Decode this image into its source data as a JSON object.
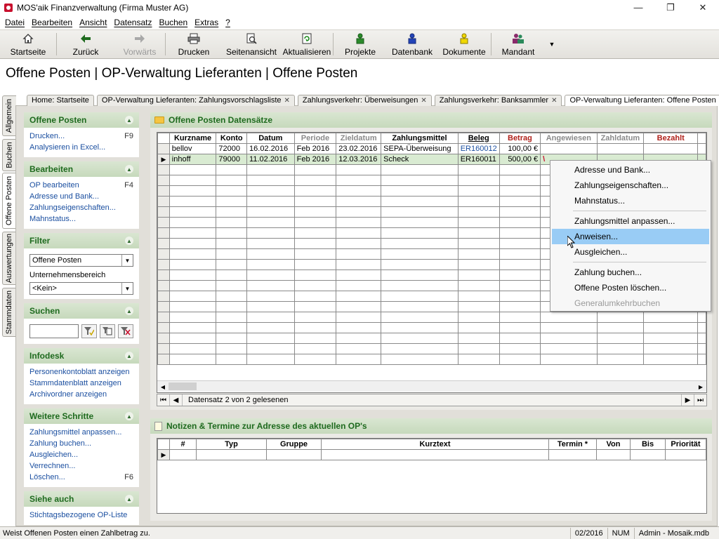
{
  "window": {
    "title": "MOS'aik Finanzverwaltung (Firma Muster AG)",
    "minimize": "—",
    "restore": "❐",
    "close": "✕"
  },
  "menubar": [
    "Datei",
    "Bearbeiten",
    "Ansicht",
    "Datensatz",
    "Buchen",
    "Extras",
    "?"
  ],
  "toolbar": {
    "startseite": "Startseite",
    "zurueck": "Zurück",
    "vorwaerts": "Vorwärts",
    "drucken": "Drucken",
    "seitenansicht": "Seitenansicht",
    "aktualisieren": "Aktualisieren",
    "projekte": "Projekte",
    "datenbank": "Datenbank",
    "dokumente": "Dokumente",
    "mandant": "Mandant"
  },
  "heading": "Offene Posten | OP-Verwaltung Lieferanten | Offene Posten",
  "vtabs": [
    "Allgemein",
    "Buchen",
    "Offene Posten",
    "Auswertungen",
    "Stammdaten"
  ],
  "htabs": [
    "Home: Startseite",
    "OP-Verwaltung Lieferanten: Zahlungsvorschlagsliste",
    "Zahlungsverkehr: Überweisungen",
    "Zahlungsverkehr: Banksammler",
    "OP-Verwaltung Lieferanten: Offene Posten"
  ],
  "left": {
    "offene_posten": {
      "title": "Offene Posten",
      "drucken": "Drucken...",
      "drucken_key": "F9",
      "excel": "Analysieren in Excel..."
    },
    "bearbeiten": {
      "title": "Bearbeiten",
      "op": "OP bearbeiten",
      "op_key": "F4",
      "adresse": "Adresse und Bank...",
      "zahlung": "Zahlungseigenschaften...",
      "mahn": "Mahnstatus..."
    },
    "filter": {
      "title": "Filter",
      "value": "Offene Posten",
      "label": "Unternehmensbereich",
      "bereich": "<Kein>"
    },
    "suchen": {
      "title": "Suchen"
    },
    "infodesk": {
      "title": "Infodesk",
      "a": "Personenkontoblatt anzeigen",
      "b": "Stammdatenblatt anzeigen",
      "c": "Archivordner anzeigen"
    },
    "weitere": {
      "title": "Weitere Schritte",
      "a": "Zahlungsmittel anpassen...",
      "b": "Zahlung buchen...",
      "c": "Ausgleichen...",
      "d": "Verrechnen...",
      "e": "Löschen...",
      "e_key": "F6"
    },
    "siehe": {
      "title": "Siehe auch",
      "a": "Stichtagsbezogene OP-Liste"
    }
  },
  "panel1": {
    "title": "Offene Posten Datensätze",
    "columns": [
      "Kurzname",
      "Konto",
      "Datum",
      "Periode",
      "Zieldatum",
      "Zahlungsmittel",
      "Beleg",
      "Betrag",
      "Angewiesen",
      "Zahldatum",
      "Bezahlt"
    ],
    "rows": [
      [
        "bellov",
        "72000",
        "16.02.2016",
        "Feb 2016",
        "23.02.2016",
        "SEPA-Überweisung",
        "ER160012",
        "100,00 €",
        "",
        "",
        ""
      ],
      [
        "inhoff",
        "79000",
        "11.02.2016",
        "Feb 2016",
        "12.03.2016",
        "Scheck",
        "ER160011",
        "500,00 €",
        "",
        "",
        ""
      ]
    ],
    "status": "Datensatz 2 von 2 gelesenen"
  },
  "panel2": {
    "title": "Notizen & Termine zur Adresse des aktuellen OP's",
    "columns": [
      "#",
      "Typ",
      "Gruppe",
      "Kurztext",
      "Termin *",
      "Von",
      "Bis",
      "Priorität"
    ]
  },
  "context_menu": [
    "Adresse und Bank...",
    "Zahlungseigenschaften...",
    "Mahnstatus...",
    "Zahlungsmittel anpassen...",
    "Anweisen...",
    "Ausgleichen...",
    "Zahlung buchen...",
    "Offene Posten löschen...",
    "Generalumkehrbuchen"
  ],
  "statusbar": {
    "text": "Weist Offenen Posten einen Zahlbetrag zu.",
    "period": "02/2016",
    "num": "NUM",
    "user": "Admin - Mosaik.mdb"
  },
  "colors": {
    "section_header": "#c6d9bc",
    "section_text": "#1e6a1e",
    "link": "#1b4fa0",
    "selected_row": "#d9ebd2",
    "menu_hover": "#99ccf5"
  }
}
